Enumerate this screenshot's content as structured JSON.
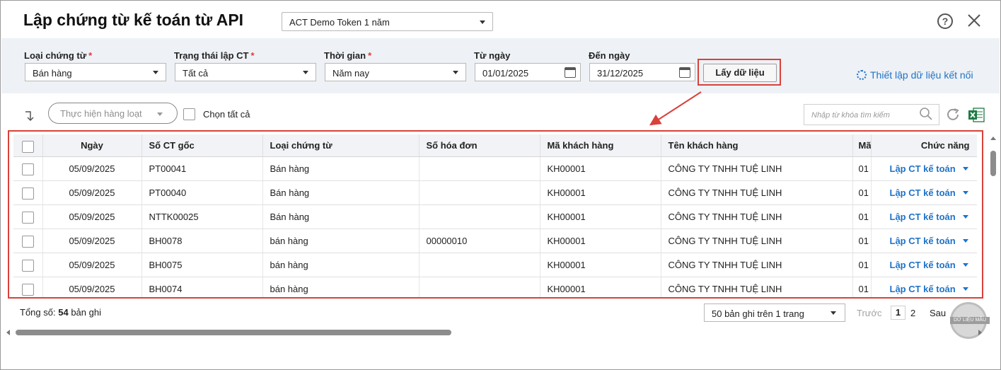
{
  "dialog": {
    "title": "Lập chứng từ kế toán từ API",
    "token_selected": "ACT Demo Token 1 năm",
    "help_icon": "help-circle-icon",
    "close_icon": "close-icon"
  },
  "filters": {
    "voucher_type": {
      "label": "Loại chứng từ",
      "required_mark": "*",
      "value": "Bán hàng"
    },
    "status": {
      "label": "Trạng thái lập CT",
      "required_mark": "*",
      "value": "Tất cả"
    },
    "period": {
      "label": "Thời gian",
      "required_mark": "*",
      "value": "Năm nay"
    },
    "from_date": {
      "label": "Từ ngày",
      "value": "01/01/2025"
    },
    "to_date": {
      "label": "Đến ngày",
      "value": "31/12/2025"
    },
    "fetch_button": "Lấy dữ liệu",
    "settings_link": "Thiết lập dữ liệu kết nối"
  },
  "toolbar": {
    "bulk_action": "Thực hiện hàng loạt",
    "select_all": "Chọn tất cả",
    "search_placeholder": "Nhập từ khóa tìm kiếm"
  },
  "grid": {
    "columns": [
      "Ngày",
      "Số CT gốc",
      "Loại chứng từ",
      "Số hóa đơn",
      "Mã khách hàng",
      "Tên khách hàng",
      "Mã",
      "Chức năng"
    ],
    "rows": [
      {
        "date": "05/09/2025",
        "doc_no": "PT00041",
        "type": "Bán hàng",
        "invoice": "",
        "customer_code": "KH00001",
        "customer_name": "CÔNG TY TNHH TUỆ LINH",
        "extra": "01",
        "action": "Lập CT kế toán"
      },
      {
        "date": "05/09/2025",
        "doc_no": "PT00040",
        "type": "Bán hàng",
        "invoice": "",
        "customer_code": "KH00001",
        "customer_name": "CÔNG TY TNHH TUỆ LINH",
        "extra": "01",
        "action": "Lập CT kế toán"
      },
      {
        "date": "05/09/2025",
        "doc_no": "NTTK00025",
        "type": "Bán hàng",
        "invoice": "",
        "customer_code": "KH00001",
        "customer_name": "CÔNG TY TNHH TUỆ LINH",
        "extra": "01",
        "action": "Lập CT kế toán"
      },
      {
        "date": "05/09/2025",
        "doc_no": "BH0078",
        "type": "bán hàng",
        "invoice": "00000010",
        "customer_code": "KH00001",
        "customer_name": "CÔNG TY TNHH TUỆ LINH",
        "extra": "01",
        "action": "Lập CT kế toán"
      },
      {
        "date": "05/09/2025",
        "doc_no": "BH0075",
        "type": "bán hàng",
        "invoice": "",
        "customer_code": "KH00001",
        "customer_name": "CÔNG TY TNHH TUỆ LINH",
        "extra": "01",
        "action": "Lập CT kế toán"
      },
      {
        "date": "05/09/2025",
        "doc_no": "BH0074",
        "type": "bán hàng",
        "invoice": "",
        "customer_code": "KH00001",
        "customer_name": "CÔNG TY TNHH TUỆ LINH",
        "extra": "01",
        "action": "Lập CT kế toán"
      }
    ]
  },
  "footer": {
    "total_prefix": "Tổng số:",
    "total_count": "54",
    "total_suffix": "bản ghi",
    "page_size": "50 bản ghi trên 1 trang",
    "prev": "Trước",
    "pages": [
      "1",
      "2"
    ],
    "next": "Sau",
    "watermark": "DỮ LIỆU MẪU"
  },
  "colors": {
    "accent": "#1e73c8",
    "highlight": "#d9413a",
    "filter_bg": "#eef1f5"
  }
}
